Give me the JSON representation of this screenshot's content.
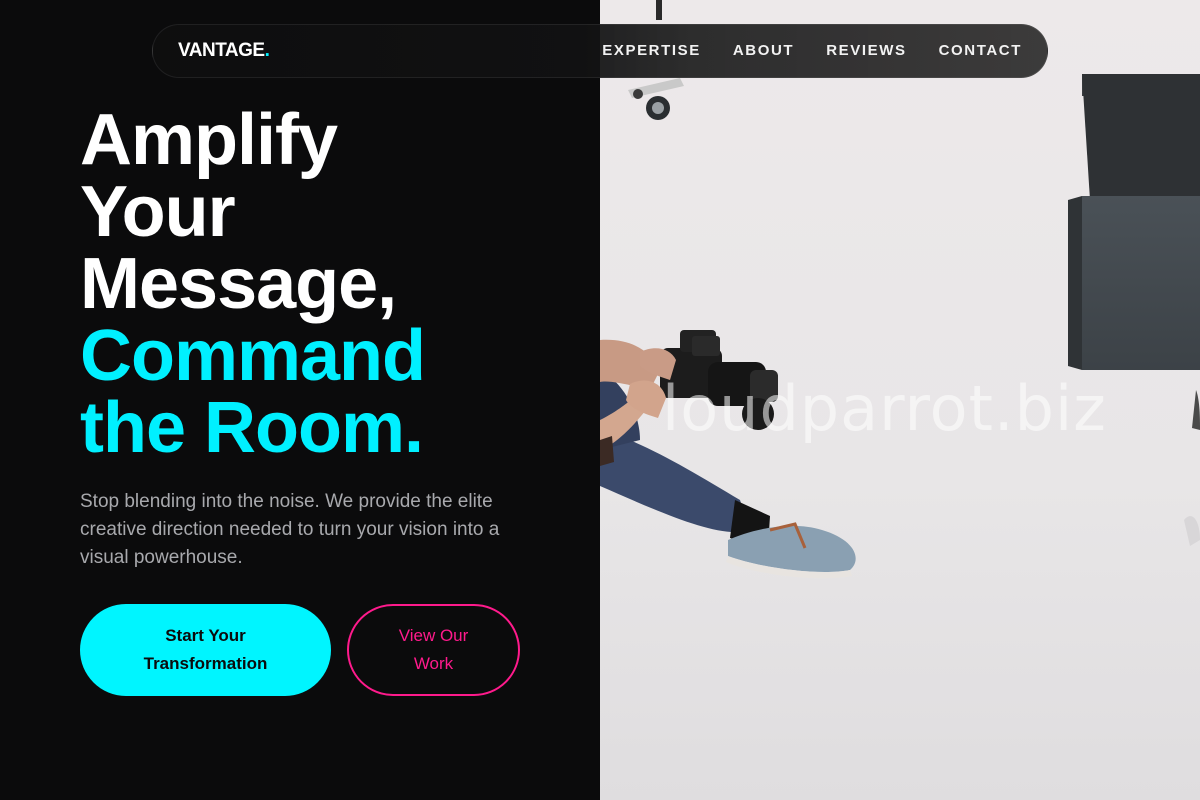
{
  "brand": {
    "name": "VANTAGE",
    "dot": ".",
    "accent": "#00f0ff"
  },
  "nav": {
    "links": [
      "EXPERTISE",
      "ABOUT",
      "REVIEWS",
      "CONTACT"
    ]
  },
  "hero": {
    "headline_white": [
      "Amplify",
      "Your",
      "Message,"
    ],
    "headline_cyan": [
      "Command",
      "the Room."
    ],
    "subtext": "Stop blending into the noise. We provide the elite creative direction needed to turn your vision into a visual powerhouse.",
    "primary_cta": "Start Your Transformation",
    "secondary_cta": "View Our Work"
  },
  "image": {
    "watermark": "loudparrot.biz"
  },
  "colors": {
    "background": "#0b0b0c",
    "cyan": "#00f0ff",
    "pink": "#ff1a8c",
    "muted_text": "#a8a9ad"
  }
}
